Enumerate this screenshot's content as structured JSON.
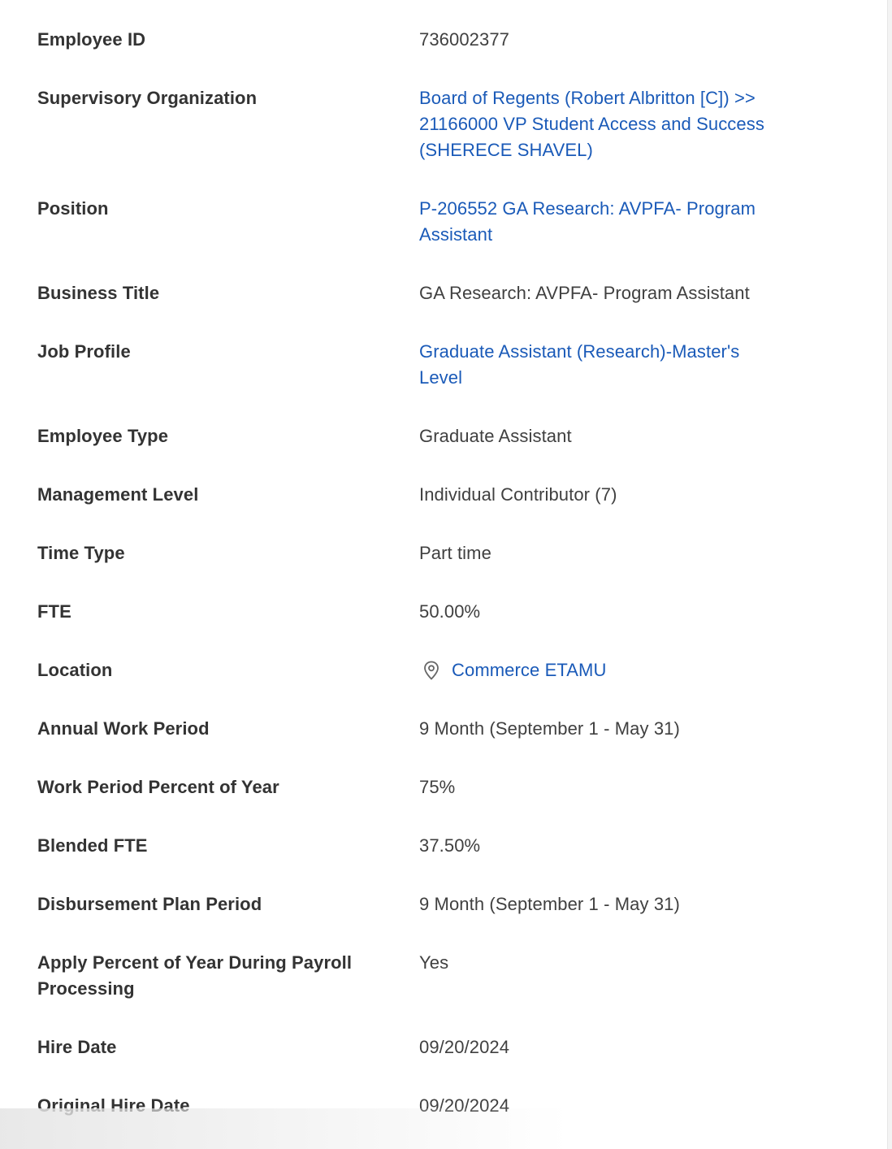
{
  "fields": [
    {
      "label": "Employee ID",
      "value": "736002377"
    },
    {
      "label": "Supervisory Organization",
      "value": "Board of Regents (Robert Albritton [C]) >>\n21166000 VP Student Access and Success\n(SHERECE SHAVEL)"
    },
    {
      "label": "Position",
      "value": "P-206552 GA Research: AVPFA- Program\nAssistant"
    },
    {
      "label": "Business Title",
      "value": "GA Research: AVPFA- Program Assistant"
    },
    {
      "label": "Job Profile",
      "value": "Graduate Assistant (Research)-Master's\nLevel"
    },
    {
      "label": "Employee Type",
      "value": "Graduate Assistant"
    },
    {
      "label": "Management Level",
      "value": "Individual Contributor (7)"
    },
    {
      "label": "Time Type",
      "value": "Part time"
    },
    {
      "label": "FTE",
      "value": "50.00%"
    },
    {
      "label": "Location",
      "value": "Commerce ETAMU",
      "icon": "location-pin-icon"
    },
    {
      "label": "Annual Work Period",
      "value": "9 Month (September 1 - May 31)"
    },
    {
      "label": "Work Period Percent of Year",
      "value": "75%"
    },
    {
      "label": "Blended FTE",
      "value": "37.50%"
    },
    {
      "label": "Disbursement Plan Period",
      "value": "9 Month (September 1 - May 31)"
    },
    {
      "label": "Apply Percent of Year During Payroll\nProcessing",
      "value": "Yes"
    },
    {
      "label": "Hire Date",
      "value": "09/20/2024"
    },
    {
      "label": "Original Hire Date",
      "value": "09/20/2024"
    }
  ],
  "colors": {
    "link": "#1a5ab8",
    "label": "#333333",
    "value": "#404040"
  }
}
